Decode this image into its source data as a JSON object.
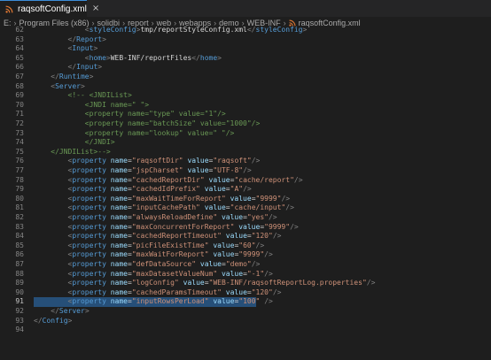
{
  "tab": {
    "label": "raqsoftConfig.xml",
    "close": "×"
  },
  "breadcrumb": {
    "parts": [
      "E:",
      "Program Files (x86)",
      "solidbi",
      "report",
      "web",
      "webapps",
      "demo",
      "WEB-INF"
    ],
    "file": "raqsoftConfig.xml"
  },
  "editor": {
    "current_line": 91,
    "lines": [
      {
        "n": "62",
        "t": "            <styleConfig>tmp/reportStyleConfig.xml</styleConfig>"
      },
      {
        "n": "63",
        "t": "        </Report>"
      },
      {
        "n": "64",
        "t": "        <Input>"
      },
      {
        "n": "65",
        "t": "            <home>WEB-INF/reportFiles</home>"
      },
      {
        "n": "66",
        "t": "        </Input>"
      },
      {
        "n": "67",
        "t": "    </Runtime>"
      },
      {
        "n": "68",
        "t": "    <Server>"
      },
      {
        "n": "69",
        "t": "        <!-- <JNDIList>"
      },
      {
        "n": "70",
        "t": "            <JNDI name=\" \">"
      },
      {
        "n": "71",
        "t": "            <property name=\"type\" value=\"1\"/>"
      },
      {
        "n": "72",
        "t": "            <property name=\"batchSize\" value=\"1000\"/>"
      },
      {
        "n": "73",
        "t": "            <property name=\"lookup\" value=\" \"/>"
      },
      {
        "n": "74",
        "t": "            </JNDI>"
      },
      {
        "n": "75",
        "t": "    </JNDIList>-->"
      },
      {
        "n": "76",
        "t": "        <property name=\"raqsoftDir\" value=\"raqsoft\"/>"
      },
      {
        "n": "77",
        "t": "        <property name=\"jspCharset\" value=\"UTF-8\"/>"
      },
      {
        "n": "78",
        "t": "        <property name=\"cachedReportDir\" value=\"cache/report\"/>"
      },
      {
        "n": "79",
        "t": "        <property name=\"cachedIdPrefix\" value=\"A\"/>"
      },
      {
        "n": "80",
        "t": "        <property name=\"maxWaitTimeForReport\" value=\"9999\"/>"
      },
      {
        "n": "81",
        "t": "        <property name=\"inputCachePath\" value=\"cache/input\"/>"
      },
      {
        "n": "82",
        "t": "        <property name=\"alwaysReloadDefine\" value=\"yes\"/>"
      },
      {
        "n": "83",
        "t": "        <property name=\"maxConcurrentForReport\" value=\"9999\"/>"
      },
      {
        "n": "84",
        "t": "        <property name=\"cachedReportTimeout\" value=\"120\"/>"
      },
      {
        "n": "85",
        "t": "        <property name=\"picFileExistTime\" value=\"60\"/>"
      },
      {
        "n": "86",
        "t": "        <property name=\"maxWaitForReport\" value=\"9999\"/>"
      },
      {
        "n": "87",
        "t": "        <property name=\"defDataSource\" value=\"demo\"/>"
      },
      {
        "n": "88",
        "t": "        <property name=\"maxDatasetValueNum\" value=\"-1\"/>"
      },
      {
        "n": "89",
        "t": "        <property name=\"logConfig\" value=\"WEB-INF/raqsoftReportLog.properties\"/>"
      },
      {
        "n": "90",
        "t": "        <property name=\"cachedParamsTimeout\" value=\"120\"/>"
      },
      {
        "n": "91",
        "t": "        <property name=\"inputRowsPerLoad\" value=\"100\" />"
      },
      {
        "n": "92",
        "t": "    </Server>"
      },
      {
        "n": "93",
        "t": "</Config>"
      },
      {
        "n": "94",
        "t": ""
      }
    ]
  },
  "colors": {
    "background": "#1e1e1e",
    "tag": "#569cd6",
    "attribute": "#9cdcfe",
    "string": "#ce9178",
    "comment": "#6a9955",
    "selection": "#264f78"
  },
  "icons": {
    "tab": "rss-xml-icon",
    "breadcrumb_file": "rss-xml-icon",
    "close": "close-icon"
  }
}
